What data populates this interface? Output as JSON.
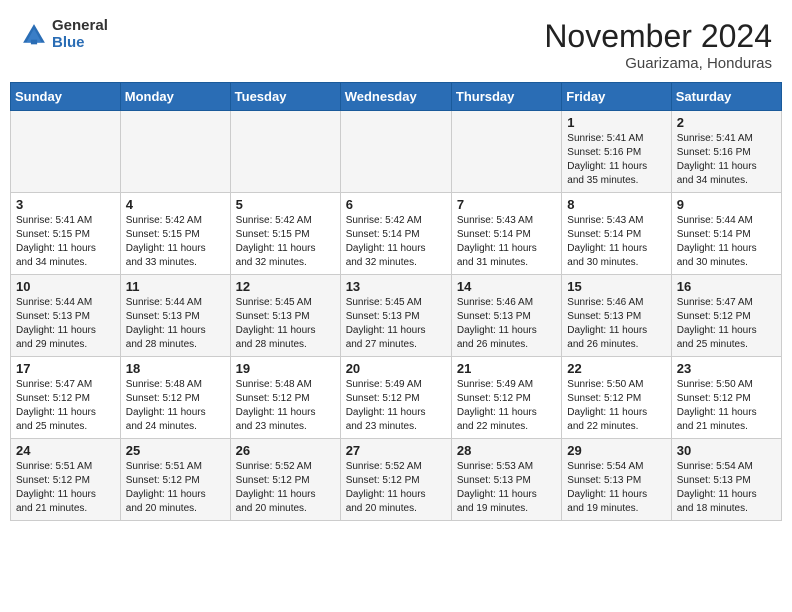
{
  "logo": {
    "general": "General",
    "blue": "Blue"
  },
  "header": {
    "month": "November 2024",
    "location": "Guarizama, Honduras"
  },
  "weekdays": [
    "Sunday",
    "Monday",
    "Tuesday",
    "Wednesday",
    "Thursday",
    "Friday",
    "Saturday"
  ],
  "weeks": [
    [
      {
        "day": "",
        "info": ""
      },
      {
        "day": "",
        "info": ""
      },
      {
        "day": "",
        "info": ""
      },
      {
        "day": "",
        "info": ""
      },
      {
        "day": "",
        "info": ""
      },
      {
        "day": "1",
        "info": "Sunrise: 5:41 AM\nSunset: 5:16 PM\nDaylight: 11 hours\nand 35 minutes."
      },
      {
        "day": "2",
        "info": "Sunrise: 5:41 AM\nSunset: 5:16 PM\nDaylight: 11 hours\nand 34 minutes."
      }
    ],
    [
      {
        "day": "3",
        "info": "Sunrise: 5:41 AM\nSunset: 5:15 PM\nDaylight: 11 hours\nand 34 minutes."
      },
      {
        "day": "4",
        "info": "Sunrise: 5:42 AM\nSunset: 5:15 PM\nDaylight: 11 hours\nand 33 minutes."
      },
      {
        "day": "5",
        "info": "Sunrise: 5:42 AM\nSunset: 5:15 PM\nDaylight: 11 hours\nand 32 minutes."
      },
      {
        "day": "6",
        "info": "Sunrise: 5:42 AM\nSunset: 5:14 PM\nDaylight: 11 hours\nand 32 minutes."
      },
      {
        "day": "7",
        "info": "Sunrise: 5:43 AM\nSunset: 5:14 PM\nDaylight: 11 hours\nand 31 minutes."
      },
      {
        "day": "8",
        "info": "Sunrise: 5:43 AM\nSunset: 5:14 PM\nDaylight: 11 hours\nand 30 minutes."
      },
      {
        "day": "9",
        "info": "Sunrise: 5:44 AM\nSunset: 5:14 PM\nDaylight: 11 hours\nand 30 minutes."
      }
    ],
    [
      {
        "day": "10",
        "info": "Sunrise: 5:44 AM\nSunset: 5:13 PM\nDaylight: 11 hours\nand 29 minutes."
      },
      {
        "day": "11",
        "info": "Sunrise: 5:44 AM\nSunset: 5:13 PM\nDaylight: 11 hours\nand 28 minutes."
      },
      {
        "day": "12",
        "info": "Sunrise: 5:45 AM\nSunset: 5:13 PM\nDaylight: 11 hours\nand 28 minutes."
      },
      {
        "day": "13",
        "info": "Sunrise: 5:45 AM\nSunset: 5:13 PM\nDaylight: 11 hours\nand 27 minutes."
      },
      {
        "day": "14",
        "info": "Sunrise: 5:46 AM\nSunset: 5:13 PM\nDaylight: 11 hours\nand 26 minutes."
      },
      {
        "day": "15",
        "info": "Sunrise: 5:46 AM\nSunset: 5:13 PM\nDaylight: 11 hours\nand 26 minutes."
      },
      {
        "day": "16",
        "info": "Sunrise: 5:47 AM\nSunset: 5:12 PM\nDaylight: 11 hours\nand 25 minutes."
      }
    ],
    [
      {
        "day": "17",
        "info": "Sunrise: 5:47 AM\nSunset: 5:12 PM\nDaylight: 11 hours\nand 25 minutes."
      },
      {
        "day": "18",
        "info": "Sunrise: 5:48 AM\nSunset: 5:12 PM\nDaylight: 11 hours\nand 24 minutes."
      },
      {
        "day": "19",
        "info": "Sunrise: 5:48 AM\nSunset: 5:12 PM\nDaylight: 11 hours\nand 23 minutes."
      },
      {
        "day": "20",
        "info": "Sunrise: 5:49 AM\nSunset: 5:12 PM\nDaylight: 11 hours\nand 23 minutes."
      },
      {
        "day": "21",
        "info": "Sunrise: 5:49 AM\nSunset: 5:12 PM\nDaylight: 11 hours\nand 22 minutes."
      },
      {
        "day": "22",
        "info": "Sunrise: 5:50 AM\nSunset: 5:12 PM\nDaylight: 11 hours\nand 22 minutes."
      },
      {
        "day": "23",
        "info": "Sunrise: 5:50 AM\nSunset: 5:12 PM\nDaylight: 11 hours\nand 21 minutes."
      }
    ],
    [
      {
        "day": "24",
        "info": "Sunrise: 5:51 AM\nSunset: 5:12 PM\nDaylight: 11 hours\nand 21 minutes."
      },
      {
        "day": "25",
        "info": "Sunrise: 5:51 AM\nSunset: 5:12 PM\nDaylight: 11 hours\nand 20 minutes."
      },
      {
        "day": "26",
        "info": "Sunrise: 5:52 AM\nSunset: 5:12 PM\nDaylight: 11 hours\nand 20 minutes."
      },
      {
        "day": "27",
        "info": "Sunrise: 5:52 AM\nSunset: 5:12 PM\nDaylight: 11 hours\nand 20 minutes."
      },
      {
        "day": "28",
        "info": "Sunrise: 5:53 AM\nSunset: 5:13 PM\nDaylight: 11 hours\nand 19 minutes."
      },
      {
        "day": "29",
        "info": "Sunrise: 5:54 AM\nSunset: 5:13 PM\nDaylight: 11 hours\nand 19 minutes."
      },
      {
        "day": "30",
        "info": "Sunrise: 5:54 AM\nSunset: 5:13 PM\nDaylight: 11 hours\nand 18 minutes."
      }
    ]
  ]
}
